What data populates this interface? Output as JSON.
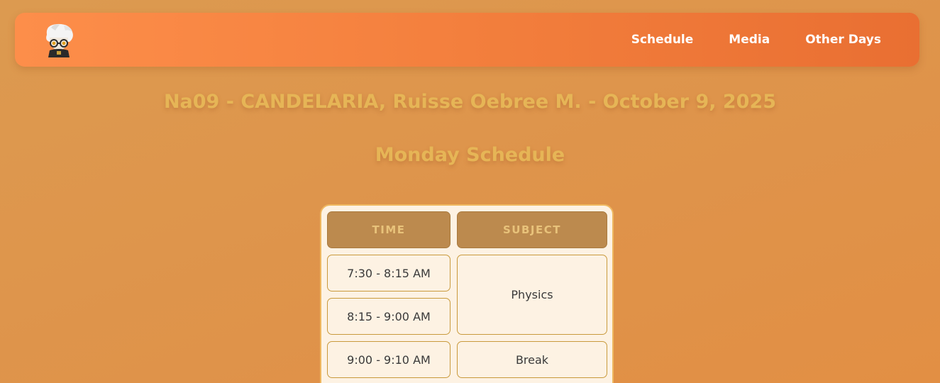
{
  "nav": {
    "logo_icon": "character-avatar-icon",
    "links": [
      "Schedule",
      "Media",
      "Other Days"
    ]
  },
  "header": {
    "title": "Na09 - CANDELARIA, Ruisse Oebree M. - October 9, 2025",
    "subtitle": "Monday Schedule"
  },
  "table": {
    "columns": [
      "TIME",
      "SUBJECT"
    ],
    "times": [
      "7:30 - 8:15 AM",
      "8:15 - 9:00 AM",
      "9:00 - 9:10 AM"
    ],
    "subjects": [
      "Physics",
      "Break"
    ]
  },
  "colors": {
    "navbar_start": "#fd8e4a",
    "navbar_end": "#e96f32",
    "title": "#e6b556",
    "card_bg": "#fdf2e3",
    "header_cell": "#bc8a4e"
  }
}
